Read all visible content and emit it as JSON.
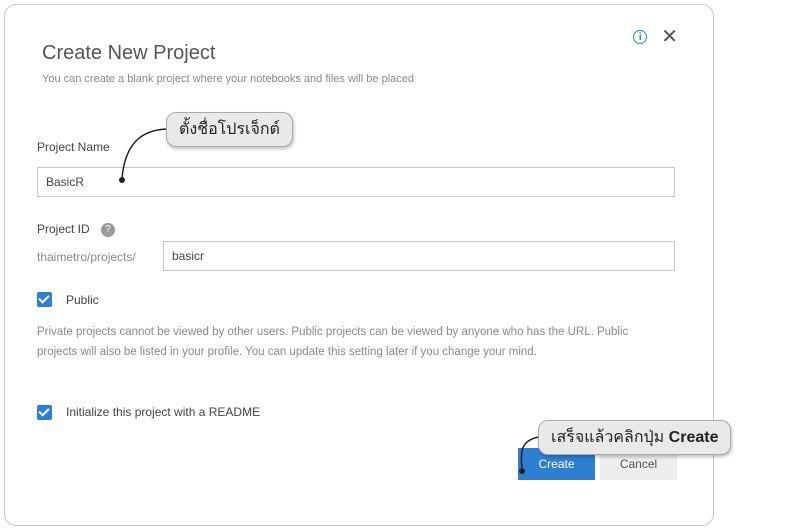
{
  "dialog": {
    "title": "Create New Project",
    "subtitle": "You can create a blank project where your notebooks and files will be placed"
  },
  "form": {
    "project_name_label": "Project Name",
    "project_name_value": "BasicR",
    "project_id_label": "Project ID",
    "project_id_help": "?",
    "project_id_prefix": "thaimetro/projects/",
    "project_id_value": "basicr",
    "public_label": "Public",
    "public_checked": true,
    "public_description": "Private projects cannot be viewed by other users. Public projects can be viewed by anyone who has the URL. Public projects will also be listed in your profile. You can update this setting later if you change your mind.",
    "readme_label": "Initialize this project with a README",
    "readme_checked": true
  },
  "buttons": {
    "create": "Create",
    "cancel": "Cancel"
  },
  "annotations": {
    "callout_name": "ตั้งชื่อโปรเจ็กต์",
    "callout_create_prefix": "เสร็จแล้วคลิกปุ่ม",
    "callout_create_bold": "Create"
  },
  "colors": {
    "accent": "#2d7fd3",
    "callout_bg": "#e9e9e9"
  }
}
